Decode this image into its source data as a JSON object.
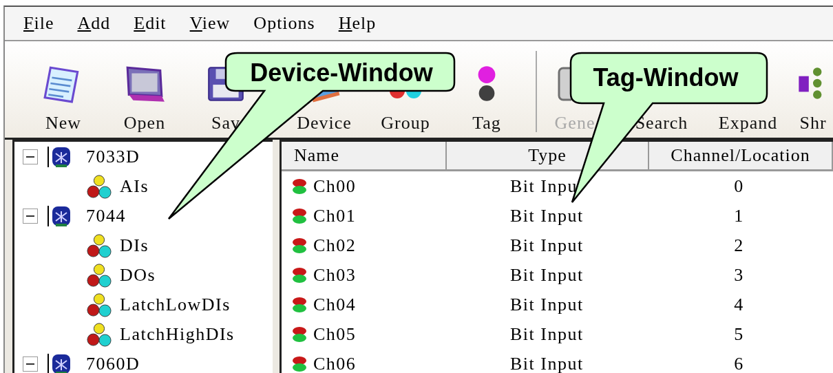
{
  "menu": [
    {
      "label": "File",
      "mnemonic_first": true
    },
    {
      "label": "Add",
      "mnemonic_first": true
    },
    {
      "label": "Edit",
      "mnemonic_first": true
    },
    {
      "label": "View",
      "mnemonic_first": true
    },
    {
      "label": "Options",
      "mnemonic_first": false
    },
    {
      "label": "Help",
      "mnemonic_first": true
    }
  ],
  "toolbar": [
    {
      "kind": "new",
      "label": "New",
      "disabled": false
    },
    {
      "kind": "open",
      "label": "Open",
      "disabled": false
    },
    {
      "kind": "save",
      "label": "Sav",
      "disabled": false
    },
    {
      "kind": "device",
      "label": "Device",
      "disabled": false
    },
    {
      "kind": "group",
      "label": "Group",
      "disabled": false
    },
    {
      "kind": "tag",
      "label": "Tag",
      "disabled": false
    },
    {
      "kind": "separator"
    },
    {
      "kind": "generate",
      "label": "Gene",
      "disabled": true
    },
    {
      "kind": "search",
      "label": "Search",
      "disabled": false
    },
    {
      "kind": "expand",
      "label": "Expand",
      "disabled": false
    },
    {
      "kind": "shrink",
      "label": "Shr",
      "disabled": false
    }
  ],
  "tree": [
    {
      "kind": "device",
      "label": "7033D",
      "expanded": true,
      "children": [
        {
          "kind": "group",
          "label": "AIs"
        }
      ]
    },
    {
      "kind": "device",
      "label": "7044",
      "expanded": true,
      "children": [
        {
          "kind": "group",
          "label": "DIs"
        },
        {
          "kind": "group",
          "label": "DOs"
        },
        {
          "kind": "group",
          "label": "LatchLowDIs"
        },
        {
          "kind": "group",
          "label": "LatchHighDIs"
        }
      ]
    },
    {
      "kind": "device",
      "label": "7060D",
      "expanded": true
    }
  ],
  "tag_list": {
    "columns": [
      "Name",
      "Type",
      "Channel/Location"
    ],
    "rows": [
      {
        "name": "Ch00",
        "type": "Bit Inpu",
        "channel": "0"
      },
      {
        "name": "Ch01",
        "type": "Bit Input",
        "channel": "1"
      },
      {
        "name": "Ch02",
        "type": "Bit Input",
        "channel": "2"
      },
      {
        "name": "Ch03",
        "type": "Bit Input",
        "channel": "3"
      },
      {
        "name": "Ch04",
        "type": "Bit Input",
        "channel": "4"
      },
      {
        "name": "Ch05",
        "type": "Bit Input",
        "channel": "5"
      },
      {
        "name": "Ch06",
        "type": "Bit Input",
        "channel": "6"
      }
    ]
  },
  "callouts": [
    {
      "text": "Device-Window"
    },
    {
      "text": "Tag-Window"
    }
  ]
}
